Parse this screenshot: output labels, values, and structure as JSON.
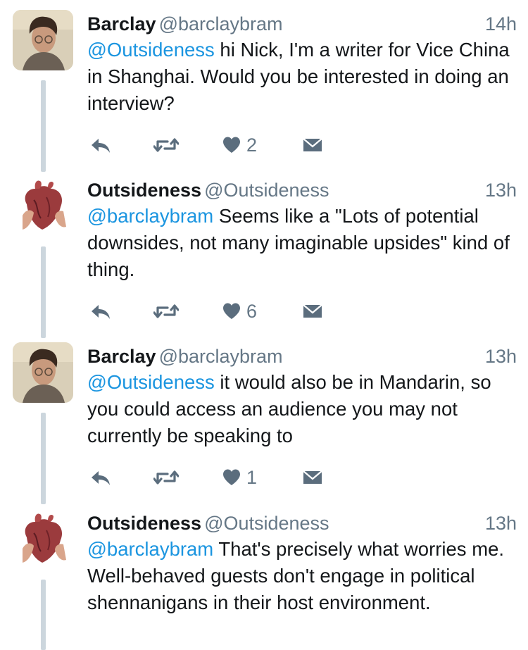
{
  "colors": {
    "link": "#1b95e0",
    "muted": "#657786",
    "thread_line": "#ccd6dd",
    "action_icon": "#5b6d7d"
  },
  "tweets": [
    {
      "avatar": "person-photo",
      "display_name": "Barclay",
      "handle": "@barclaybram",
      "time": "14h",
      "mention": "@Outsideness",
      "text": " hi Nick, I'm a writer for Vice China in Shanghai. Would you be interested in doing an interview?",
      "like_count": "2",
      "icons": [
        "reply-icon",
        "retweet-icon",
        "heart-icon",
        "envelope-icon"
      ]
    },
    {
      "avatar": "anatomical-heart-photo",
      "display_name": "Outsideness",
      "handle": "@Outsideness",
      "time": "13h",
      "mention": "@barclaybram",
      "text": " Seems like a \"Lots of potential downsides, not many imaginable upsides\" kind of thing.",
      "like_count": "6",
      "icons": [
        "reply-icon",
        "retweet-icon",
        "heart-icon",
        "envelope-icon"
      ]
    },
    {
      "avatar": "person-photo",
      "display_name": "Barclay",
      "handle": "@barclaybram",
      "time": "13h",
      "mention": "@Outsideness",
      "text": " it would also be in Mandarin, so you could access an audience you may not currently be speaking to",
      "like_count": "1",
      "icons": [
        "reply-icon",
        "retweet-icon",
        "heart-icon",
        "envelope-icon"
      ]
    },
    {
      "avatar": "anatomical-heart-photo",
      "display_name": "Outsideness",
      "handle": "@Outsideness",
      "time": "13h",
      "mention": "@barclaybram",
      "text": " That's precisely what worries me. Well-behaved guests don't engage in political shennanigans in their host environment."
    }
  ]
}
